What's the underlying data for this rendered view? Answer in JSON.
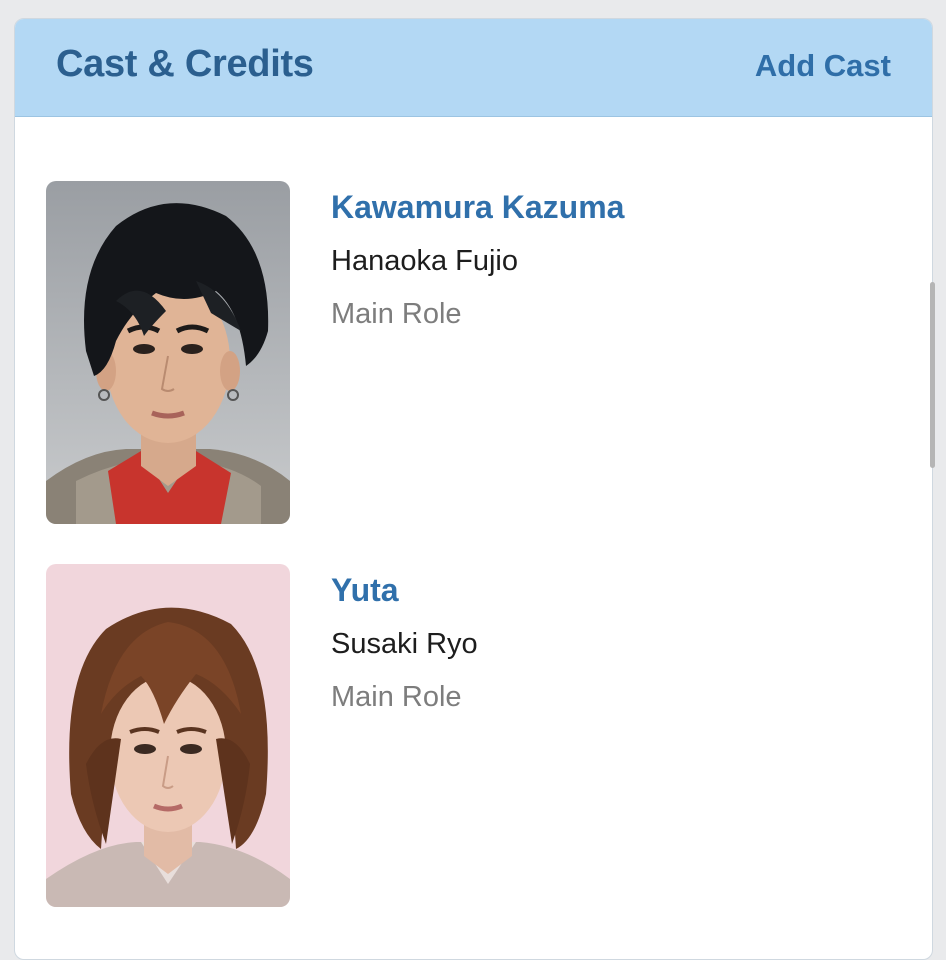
{
  "header": {
    "title": "Cast & Credits",
    "action_label": "Add Cast"
  },
  "cast": [
    {
      "actor": "Kawamura Kazuma",
      "character": "Hanaoka Fujio",
      "role": "Main Role",
      "photo_icon": "actor-photo-icon"
    },
    {
      "actor": "Yuta",
      "character": "Susaki Ryo",
      "role": "Main Role",
      "photo_icon": "actor-photo-icon"
    }
  ],
  "colors": {
    "header_bg": "#b3d8f4",
    "title": "#2b5f8f",
    "link": "#3070ab",
    "secondary_text": "#7d7d7d"
  }
}
